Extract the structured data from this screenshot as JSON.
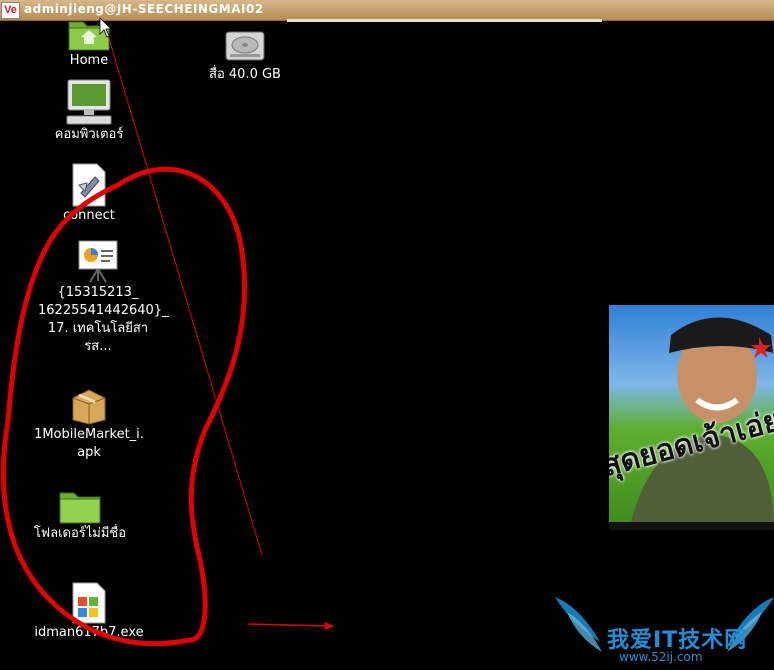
{
  "window": {
    "title": "adminjieng@JH-SEECHEINGMAI02",
    "logo_text": "Ve"
  },
  "desktop_icons": [
    {
      "label": "Home"
    },
    {
      "label": "คอมพิวเตอร์"
    },
    {
      "label": "connect"
    },
    {
      "label_lines": [
        "{15315213_",
        "16225541442640}_",
        "17. เทคโนโลยีสารส..."
      ]
    },
    {
      "label_lines": [
        "1MobileMarket_i.",
        "apk"
      ]
    },
    {
      "label": "โฟลเดอร์ไม่มีชื่อ"
    },
    {
      "label": "idman617b7.exe"
    },
    {
      "label": "สื่อ 40.0 GB"
    }
  ],
  "wallpaper": {
    "caption": "สุดยอดเจ้าเอ่ย"
  },
  "watermark": {
    "chinese": "我爱IT技术网",
    "url": "www.52ij.com"
  },
  "colors": {
    "titlebar": "#c49a63",
    "annotation_red": "#e00000"
  }
}
